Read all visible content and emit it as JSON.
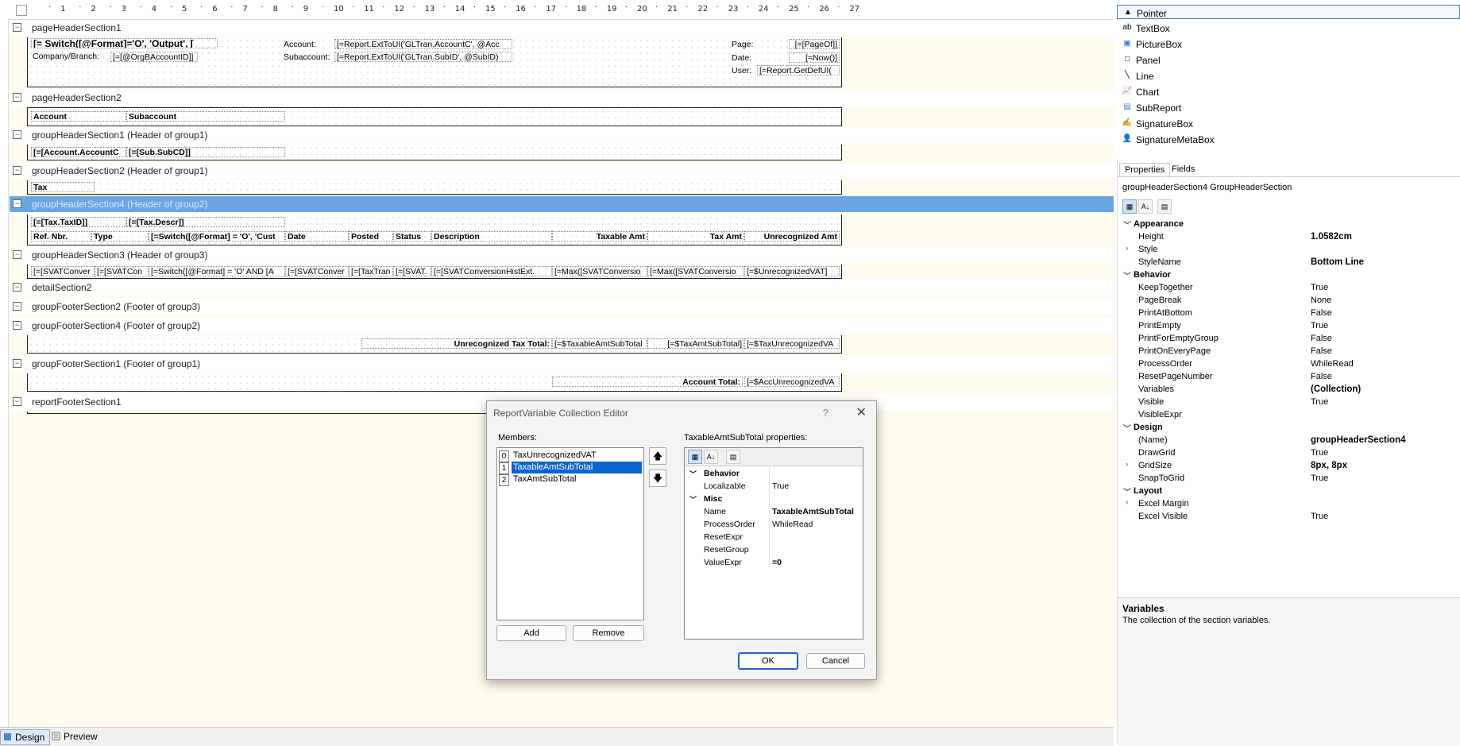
{
  "ruler": {
    "ticks": [
      "1",
      "2",
      "3",
      "4",
      "5",
      "6",
      "7",
      "8",
      "9",
      "10",
      "11",
      "12",
      "13",
      "14",
      "15",
      "16",
      "17",
      "18",
      "19",
      "20",
      "21",
      "22",
      "23",
      "24",
      "25",
      "26",
      "27"
    ]
  },
  "sections": {
    "ph1": "pageHeaderSection1",
    "ph2": "pageHeaderSection2",
    "gh1": "groupHeaderSection1 (Header of group1)",
    "gh2": "groupHeaderSection2 (Header of group1)",
    "gh4": "groupHeaderSection4 (Header of group2)",
    "gh3": "groupHeaderSection3 (Header of group3)",
    "detail": "detailSection2",
    "gf2": "groupFooterSection2 (Footer of group3)",
    "gf4": "groupFooterSection4 (Footer of group2)",
    "gf1": "groupFooterSection1 (Footer of group1)",
    "rf": "reportFooterSection1"
  },
  "toggle_glyph": "⊟",
  "bands": {
    "ph1": {
      "switch": "[= Switch([@Format]='O', 'Output', [",
      "company_label": "Company/Branch:",
      "company_value": "[=[@OrgBAccountID]]",
      "account_label": "Account:",
      "account_value": "[=Report.ExtToUI('GLTran.AccountC', @Acc",
      "subaccount_label": "Subaccount:",
      "subaccount_value": "[=Report.ExtToUI('GLTran.SubID', @SubID)",
      "page_label": "Page:",
      "page_value": "[=[PageOf]]",
      "date_label": "Date:",
      "date_value": "[=Now()]",
      "user_label": "User:",
      "user_value": "[=Report.GetDefUI("
    },
    "ph2": {
      "account": "Account",
      "subaccount": "Subaccount"
    },
    "gh1": {
      "account": "[=[Account.AccountC",
      "sub": "[=[Sub.SubCD]]"
    },
    "gh2": {
      "tax": "Tax"
    },
    "gh4": {
      "taxid": "[=[Tax.TaxID]]",
      "taxdescr": "[=[Tax.Descr]]",
      "col_ref": "Ref. Nbr.",
      "col_type": "Type",
      "col_switch": "[=Switch([@Format] = 'O', 'Cust",
      "col_date": "Date",
      "col_posted": "Posted",
      "col_status": "Status",
      "col_desc": "Description",
      "col_taxable": "Taxable Amt",
      "col_taxamt": "Tax Amt",
      "col_unrec": "Unrecognized Amt"
    },
    "gh3": {
      "c1": "[=[SVATConver",
      "c2": "[=[SVATCon",
      "c3": "[=Switch([@Format] = 'O' AND [A",
      "c4": "[=[SVATConver",
      "c5": "[=[TaxTran",
      "c6": "[=[SVAT.",
      "c7": "[=[SVATConversionHistExt.",
      "c8": "[=Max([SVATConversio",
      "c9": "[=Max([SVATConversio",
      "c10": "[=$UnrecognizedVAT]"
    },
    "gf4": {
      "label": "Unrecognized Tax Total:",
      "v1": "[=$TaxableAmtSubTotal",
      "v2": "[=$TaxAmtSubTotal]",
      "v3": "[=$TaxUnrecognizedVA"
    },
    "gf1": {
      "label": "Account Total:",
      "v1": "[=$AccUnrecognizedVA"
    }
  },
  "tabs": {
    "design": "Design",
    "preview": "Preview"
  },
  "toolbox": [
    {
      "label": "Pointer",
      "icon": "▲"
    },
    {
      "label": "TextBox",
      "icon": "ab"
    },
    {
      "label": "PictureBox",
      "icon": "▣"
    },
    {
      "label": "Panel",
      "icon": "□"
    },
    {
      "label": "Line",
      "icon": "╲"
    },
    {
      "label": "Chart",
      "icon": "📈"
    },
    {
      "label": "SubReport",
      "icon": "▤"
    },
    {
      "label": "SignatureBox",
      "icon": "✍"
    },
    {
      "label": "SignatureMetaBox",
      "icon": "👤"
    }
  ],
  "properties": {
    "tab_properties": "Properties",
    "tab_fields": "Fields",
    "object": "groupHeaderSection4  GroupHeaderSection",
    "cat_appearance": "Appearance",
    "height_name": "Height",
    "height_value": "1.0582cm",
    "style_name": "Style",
    "stylename_name": "StyleName",
    "stylename_value": "Bottom Line",
    "cat_behavior": "Behavior",
    "keeptogether_name": "KeepTogether",
    "keeptogether_value": "True",
    "pagebreak_name": "PageBreak",
    "pagebreak_value": "None",
    "printatbottom_name": "PrintAtBottom",
    "printatbottom_value": "False",
    "printempty_name": "PrintEmpty",
    "printempty_value": "True",
    "printforemptygroup_name": "PrintForEmptyGroup",
    "printforemptygroup_value": "False",
    "printoneverypage_name": "PrintOnEveryPage",
    "printoneverypage_value": "False",
    "processorder_name": "ProcessOrder",
    "processorder_value": "WhileRead",
    "resetpagenumber_name": "ResetPageNumber",
    "resetpagenumber_value": "False",
    "variables_name": "Variables",
    "variables_value": "(Collection)",
    "visible_name": "Visible",
    "visible_value": "True",
    "visibleexpr_name": "VisibleExpr",
    "cat_design": "Design",
    "name_name": "(Name)",
    "name_value": "groupHeaderSection4",
    "drawgrid_name": "DrawGrid",
    "drawgrid_value": "True",
    "gridsize_name": "GridSize",
    "gridsize_value": "8px, 8px",
    "snaptogrid_name": "SnapToGrid",
    "snaptogrid_value": "True",
    "cat_layout": "Layout",
    "excelmargin_name": "Excel Margin",
    "excelvisible_name": "Excel Visible",
    "excelvisible_value": "True",
    "desc_title": "Variables",
    "desc_text": "The collection of the section variables."
  },
  "dialog": {
    "title": "ReportVariable Collection Editor",
    "help": "?",
    "close": "✕",
    "members_label": "Members:",
    "members": [
      {
        "idx": "0",
        "name": "TaxUnrecognizedVAT"
      },
      {
        "idx": "1",
        "name": "TaxableAmtSubTotal"
      },
      {
        "idx": "2",
        "name": "TaxAmtSubTotal"
      }
    ],
    "up": "🡅",
    "down": "🡇",
    "add": "Add",
    "remove": "Remove",
    "props_label": "TaxableAmtSubTotal properties:",
    "cat_behavior": "Behavior",
    "localizable_name": "Localizable",
    "localizable_value": "True",
    "cat_misc": "Misc",
    "name_name": "Name",
    "name_value": "TaxableAmtSubTotal",
    "processorder_name": "ProcessOrder",
    "processorder_value": "WhileRead",
    "resetexpr_name": "ResetExpr",
    "resetgroup_name": "ResetGroup",
    "valueexpr_name": "ValueExpr",
    "valueexpr_value": "=0",
    "ok": "OK",
    "cancel": "Cancel"
  }
}
